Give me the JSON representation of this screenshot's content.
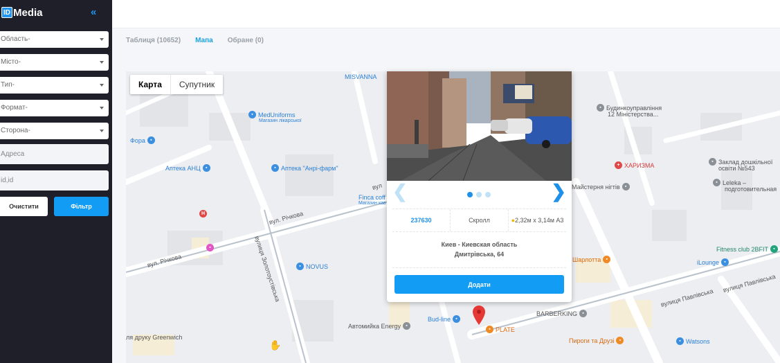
{
  "sidebar": {
    "logo_mark": "ID",
    "logo_text": "Media",
    "collapse_glyph": "«",
    "selects": [
      "Область-",
      "Місто-",
      "Тип-",
      "Формат-",
      "Сторона-"
    ],
    "address_placeholder": "Адресa",
    "id_placeholder": "id,id",
    "clear_label": "Очистити",
    "filter_label": "Фільтр"
  },
  "tabs": [
    {
      "label": "Таблиця (10652)",
      "active": false
    },
    {
      "label": "Мапа",
      "active": true
    },
    {
      "label": "Обране (0)",
      "active": false
    }
  ],
  "map": {
    "toggle": {
      "map": "Карта",
      "satellite": "Супутник"
    },
    "pois": {
      "misvanna": "MISVANNA",
      "meduniforms": "MedUniforms",
      "meduniforms_sub": "Магазин лікарської",
      "fora": "Фора",
      "apteka_anc": "Аптека АНЦ",
      "apteka_anri": "Аптека \"Анрі-фарм\"",
      "budynko": "Будинкоуправління",
      "budynko_sub": "12 Міністерства...",
      "kharyzma": "ХАРИЗМА",
      "zaklad": "Заклад дошкільної",
      "zaklad_sub": "освіти №543",
      "leleka": "Leleka –",
      "leleka_sub": "подготовительная",
      "maisternya": "Майстерня нігтів",
      "finca": "Finca coff",
      "finca_sub": "Магазин кав",
      "fitness": "Fitness club 2BFIT",
      "sharlotta": "Шарлотта",
      "ilounge": "iLounge",
      "novus": "NOVUS",
      "barberking": "BARBERKING",
      "bud_line": "Bud-line",
      "plate": "PLATE",
      "avtomyika": "Автомийка Energy",
      "pyrogy": "Пироги та Друзі",
      "watsons": "Watsons",
      "greenwich": "ля друку Greenwich"
    },
    "streets": {
      "richkova1": "вул. Річкова",
      "richkova2": "вул. Річкова",
      "zolotoust": "вулиця Золотоустівська",
      "pavlivska": "вулиця Павлівська",
      "pavlivska2": "вулиця Павлівська",
      "vul_short": "вул"
    }
  },
  "popup": {
    "id": "237630",
    "type": "Скролл",
    "size": "2,32м x 3,14м А3",
    "region": "Киев - Киевская область",
    "street": "Дмитрівська, 64",
    "add_label": "Додати",
    "slide_count": 3,
    "active_slide": 1,
    "prev_glyph": "❮",
    "next_glyph": "❯"
  }
}
